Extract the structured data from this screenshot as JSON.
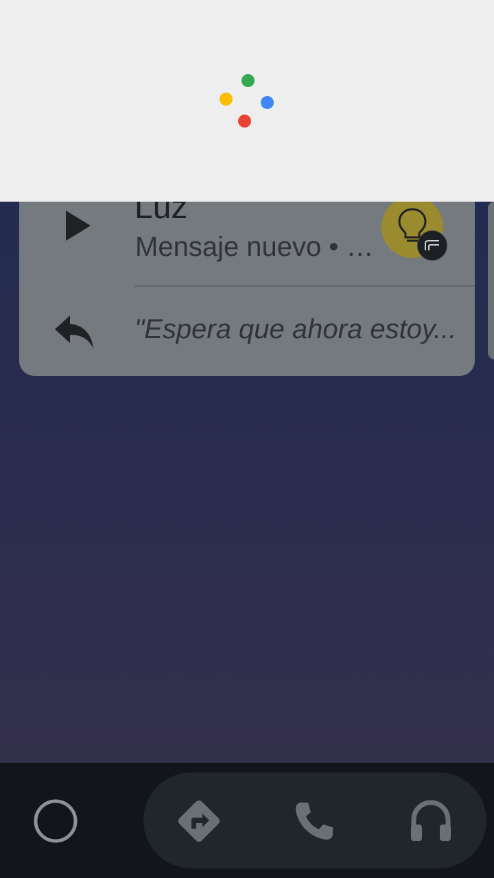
{
  "assistant": {
    "dots": {
      "green": "#34a853",
      "yellow": "#fbbc05",
      "blue": "#4285f4",
      "red": "#ea4335"
    }
  },
  "notification": {
    "sender": "Luz",
    "subtitle": "Mensaje nuevo • …",
    "reply_preview": "\"Espera que ahora estoy...",
    "play_icon": "play-icon",
    "reply_icon": "reply-icon",
    "app_icon": "lightbulb-icon",
    "badge_color": "#9a8b2e"
  },
  "nav": {
    "home_icon": "circle-home-icon",
    "items": [
      {
        "icon": "navigation-icon"
      },
      {
        "icon": "phone-icon"
      },
      {
        "icon": "headphones-icon"
      }
    ]
  }
}
